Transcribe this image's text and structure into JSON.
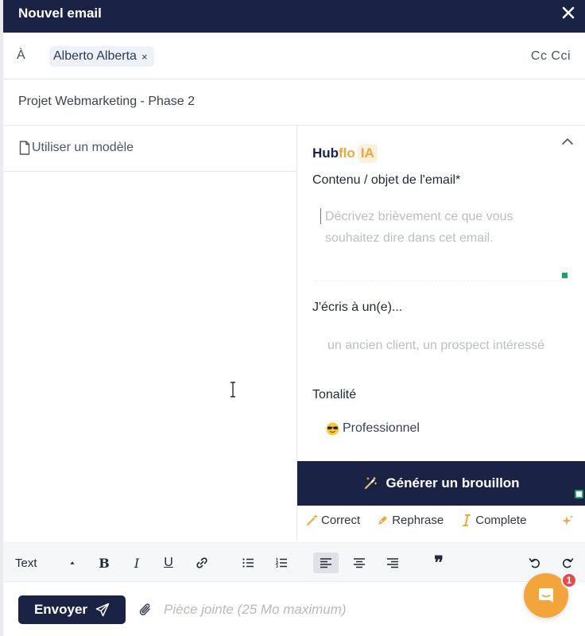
{
  "window": {
    "title": "Nouvel email"
  },
  "recipients": {
    "label": "À",
    "chips": [
      {
        "name": "Alberto Alberta",
        "remove": "×"
      }
    ],
    "cc_cci": "Cc Cci"
  },
  "subject": {
    "value": "Projet Webmarketing - Phase 2"
  },
  "template": {
    "label": "Utiliser un modèle"
  },
  "ai_panel": {
    "logo_part1": "Hub",
    "logo_part2": "flo",
    "logo_badge": "IA",
    "content_label": "Contenu / objet de l'email*",
    "content_placeholder": "Décrivez brièvement ce que vous souhaitez dire dans cet email.",
    "target_label": "J'écris à un(e)...",
    "target_placeholder": "un ancien client, un prospect intéressé",
    "tone_label": "Tonalité",
    "tone_value": "Professionnel",
    "generate_label": "Générer un brouillon"
  },
  "ai_actions": [
    {
      "label": "Correct",
      "icon": "magic-wand-icon"
    },
    {
      "label": "Rephrase",
      "icon": "pen-nib-icon"
    },
    {
      "label": "Complete",
      "icon": "text-cursor-icon"
    }
  ],
  "toolbar": {
    "text_style": "Text",
    "bold": "B",
    "italic": "I",
    "underline": "U",
    "quote": "❞"
  },
  "footer": {
    "send_label": "Envoyer",
    "attachment_hint": "Pièce jointe (25 Mo maximum)"
  },
  "chat": {
    "badge_count": "1"
  },
  "colors": {
    "navy": "#1a2346",
    "accent_orange": "#f2a53a",
    "success_green": "#22a06b",
    "badge_red": "#e5484d"
  }
}
